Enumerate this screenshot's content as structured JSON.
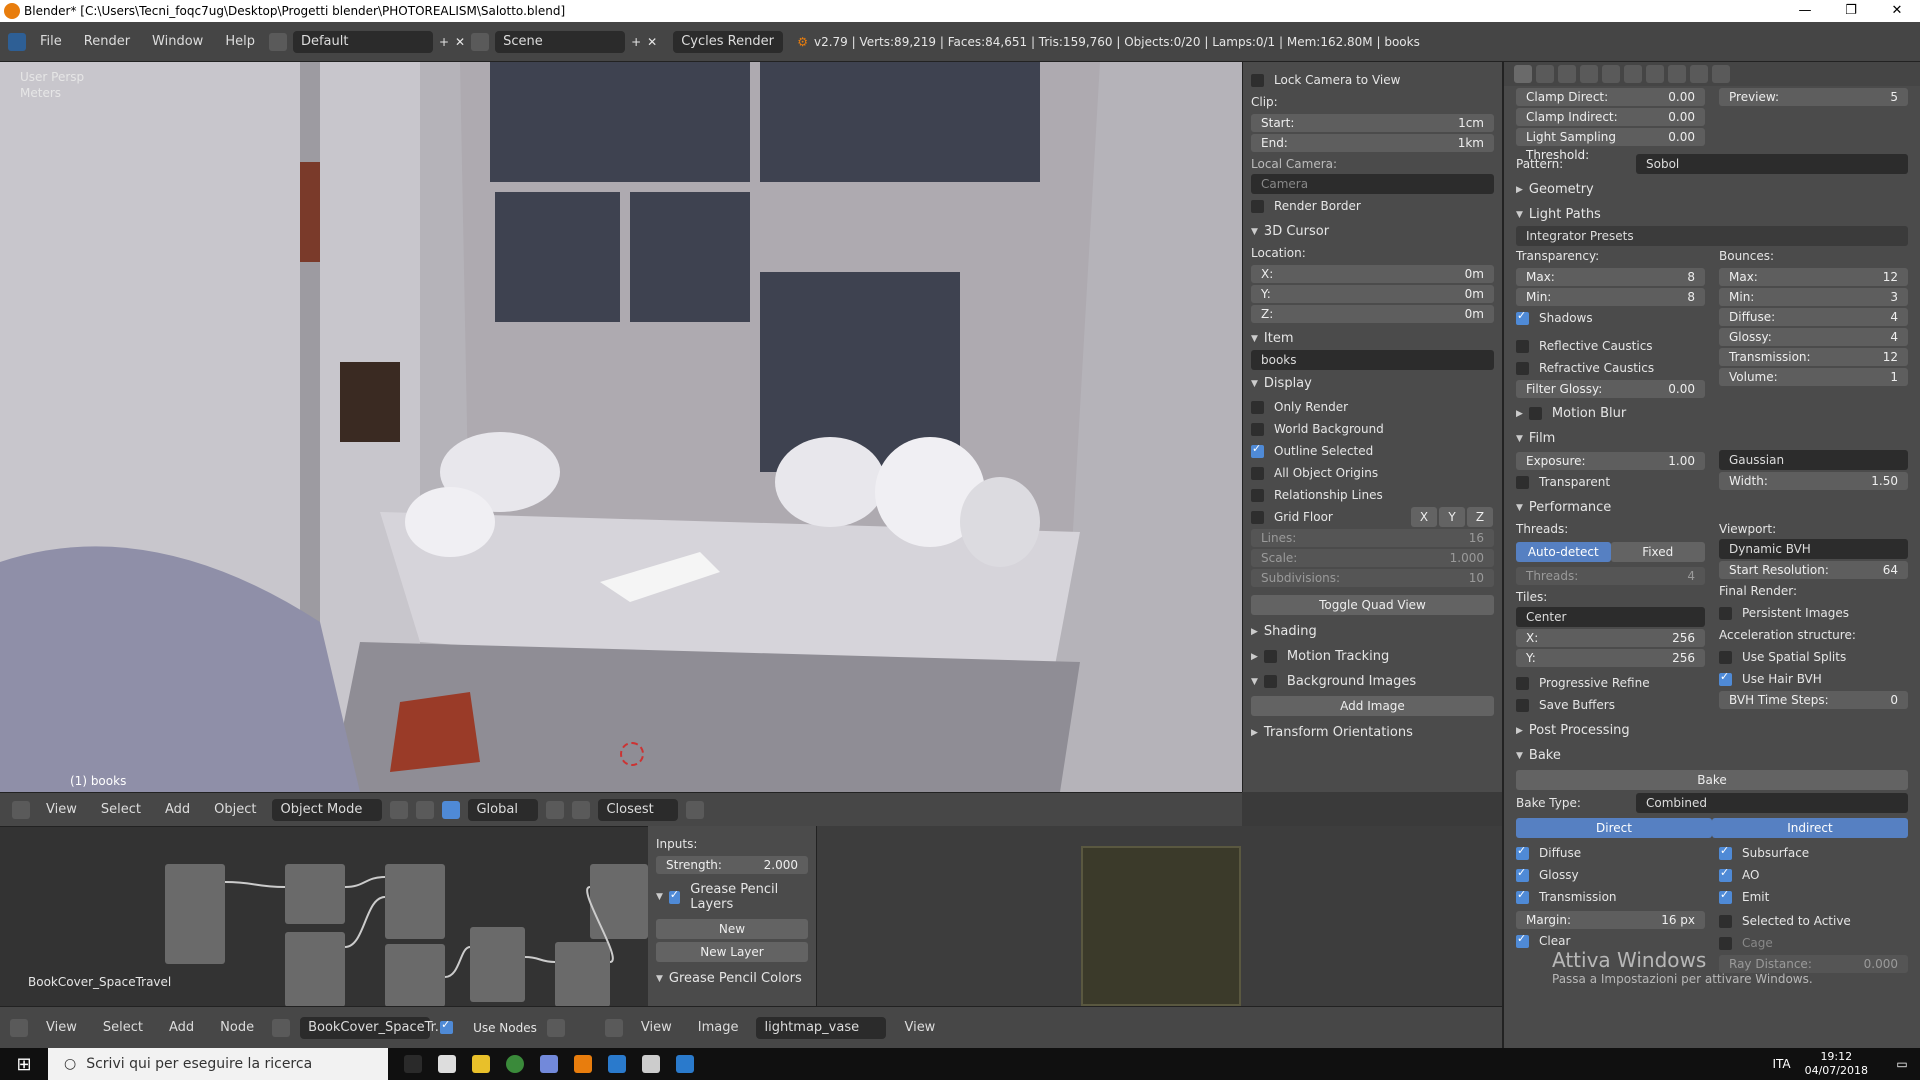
{
  "window": {
    "title": "Blender* [C:\\Users\\Tecni_foqc7ug\\Desktop\\Progetti blender\\PHOTOREALISM\\Salotto.blend]",
    "min": "—",
    "max": "❐",
    "close": "✕"
  },
  "menubar": {
    "items": [
      "File",
      "Render",
      "Window",
      "Help"
    ],
    "layout": "Default",
    "scene": "Scene",
    "engine": "Cycles Render",
    "stats": "v2.79 | Verts:89,219 | Faces:84,651 | Tris:159,760 | Objects:0/20 | Lamps:0/1 | Mem:162.80M | books"
  },
  "viewport": {
    "view_name": "User Persp",
    "units": "Meters",
    "object_label": "(1) books"
  },
  "viewport_header": {
    "items": [
      "View",
      "Select",
      "Add",
      "Object"
    ],
    "mode": "Object Mode",
    "orientation": "Global",
    "snap": "Closest"
  },
  "npanel": {
    "lock_camera": "Lock Camera to View",
    "clip_label": "Clip:",
    "clip_start_label": "Start:",
    "clip_start": "1cm",
    "clip_end_label": "End:",
    "clip_end": "1km",
    "local_camera_label": "Local Camera:",
    "local_camera": "Camera",
    "render_border": "Render Border",
    "cursor_section": "3D Cursor",
    "location_label": "Location:",
    "x_label": "X:",
    "x": "0m",
    "y_label": "Y:",
    "y": "0m",
    "z_label": "Z:",
    "z": "0m",
    "item_section": "Item",
    "item_name": "books",
    "display_section": "Display",
    "only_render": "Only Render",
    "world_background": "World Background",
    "outline_selected": "Outline Selected",
    "all_object_origins": "All Object Origins",
    "relationship_lines": "Relationship Lines",
    "grid_floor": "Grid Floor",
    "axes": [
      "X",
      "Y",
      "Z"
    ],
    "lines_label": "Lines:",
    "lines": "16",
    "scale_label": "Scale:",
    "scale": "1.000",
    "subdiv_label": "Subdivisions:",
    "subdiv": "10",
    "toggle_quad": "Toggle Quad View",
    "shading": "Shading",
    "motion_tracking": "Motion Tracking",
    "background_images": "Background Images",
    "add_image": "Add Image",
    "transform_orientations": "Transform Orientations"
  },
  "props": {
    "clamp_direct_label": "Clamp Direct:",
    "clamp_direct": "0.00",
    "clamp_indirect_label": "Clamp Indirect:",
    "clamp_indirect": "0.00",
    "light_threshold_label": "Light Sampling Threshold:",
    "light_threshold": "0.00",
    "preview_label": "Preview:",
    "preview": "5",
    "pattern_label": "Pattern:",
    "pattern": "Sobol",
    "geometry": "Geometry",
    "light_paths": "Light Paths",
    "integrator_presets": "Integrator Presets",
    "transparency_label": "Transparency:",
    "bounces_label": "Bounces:",
    "t_max_label": "Max:",
    "t_max": "8",
    "t_min_label": "Min:",
    "t_min": "8",
    "b_max_label": "Max:",
    "b_max": "12",
    "b_min_label": "Min:",
    "b_min": "3",
    "shadows": "Shadows",
    "diffuse_label": "Diffuse:",
    "diffuse": "4",
    "glossy_label": "Glossy:",
    "glossy": "4",
    "transmission_label": "Transmission:",
    "transmission": "12",
    "volume_label": "Volume:",
    "volume": "1",
    "reflective_caustics": "Reflective Caustics",
    "refractive_caustics": "Refractive Caustics",
    "filter_glossy_label": "Filter Glossy:",
    "filter_glossy": "0.00",
    "motion_blur": "Motion Blur",
    "film": "Film",
    "exposure_label": "Exposure:",
    "exposure": "1.00",
    "filter": "Gaussian",
    "transparent": "Transparent",
    "width_label": "Width:",
    "width": "1.50",
    "performance": "Performance",
    "threads_label": "Threads:",
    "auto_detect": "Auto-detect",
    "fixed": "Fixed",
    "threads_n_label": "Threads:",
    "threads_n": "4",
    "viewport_label": "Viewport:",
    "viewport_bvh": "Dynamic BVH",
    "start_res_label": "Start Resolution:",
    "start_res": "64",
    "tiles_label": "Tiles:",
    "tiles_order": "Center",
    "tx_label": "X:",
    "tx": "256",
    "ty_label": "Y:",
    "ty": "256",
    "final_render_label": "Final Render:",
    "persistent_images": "Persistent Images",
    "progressive_refine": "Progressive Refine",
    "save_buffers": "Save Buffers",
    "accel_label": "Acceleration structure:",
    "spatial_splits": "Use Spatial Splits",
    "hair_bvh": "Use Hair BVH",
    "bvh_steps_label": "BVH Time Steps:",
    "bvh_steps": "0",
    "post_processing": "Post Processing",
    "bake": "Bake",
    "bake_button": "Bake",
    "bake_type_label": "Bake Type:",
    "bake_type": "Combined",
    "direct": "Direct",
    "indirect": "Indirect",
    "b_diffuse": "Diffuse",
    "b_glossy": "Glossy",
    "b_transmission": "Transmission",
    "b_subsurface": "Subsurface",
    "b_ao": "AO",
    "b_emit": "Emit",
    "margin_label": "Margin:",
    "margin": "16 px",
    "selected_to_active": "Selected to Active",
    "clear": "Clear",
    "cage": "Cage",
    "ray_distance_label": "Ray Distance:",
    "ray_distance": "0.000",
    "watermark_line1": "Attiva Windows",
    "watermark_line2": "Passa a Impostazioni per attivare Windows."
  },
  "node_editor": {
    "material_name": "BookCover_SpaceTravel",
    "inputs_label": "Inputs:",
    "strength_label": "Strength:",
    "strength": "2.000",
    "gp_layers": "Grease Pencil Layers",
    "new": "New",
    "new_layer": "New Layer",
    "gp_colors": "Grease Pencil Colors"
  },
  "bottom_header": {
    "left_items": [
      "View",
      "Select",
      "Add",
      "Node"
    ],
    "material": "BookCover_SpaceTr...",
    "use_nodes": "Use Nodes",
    "right_items": [
      "View",
      "Image"
    ],
    "image": "lightmap_vase",
    "view": "View"
  },
  "taskbar": {
    "search": "Scrivi qui per eseguire la ricerca",
    "lang": "ITA",
    "time": "19:12",
    "date": "04/07/2018"
  }
}
